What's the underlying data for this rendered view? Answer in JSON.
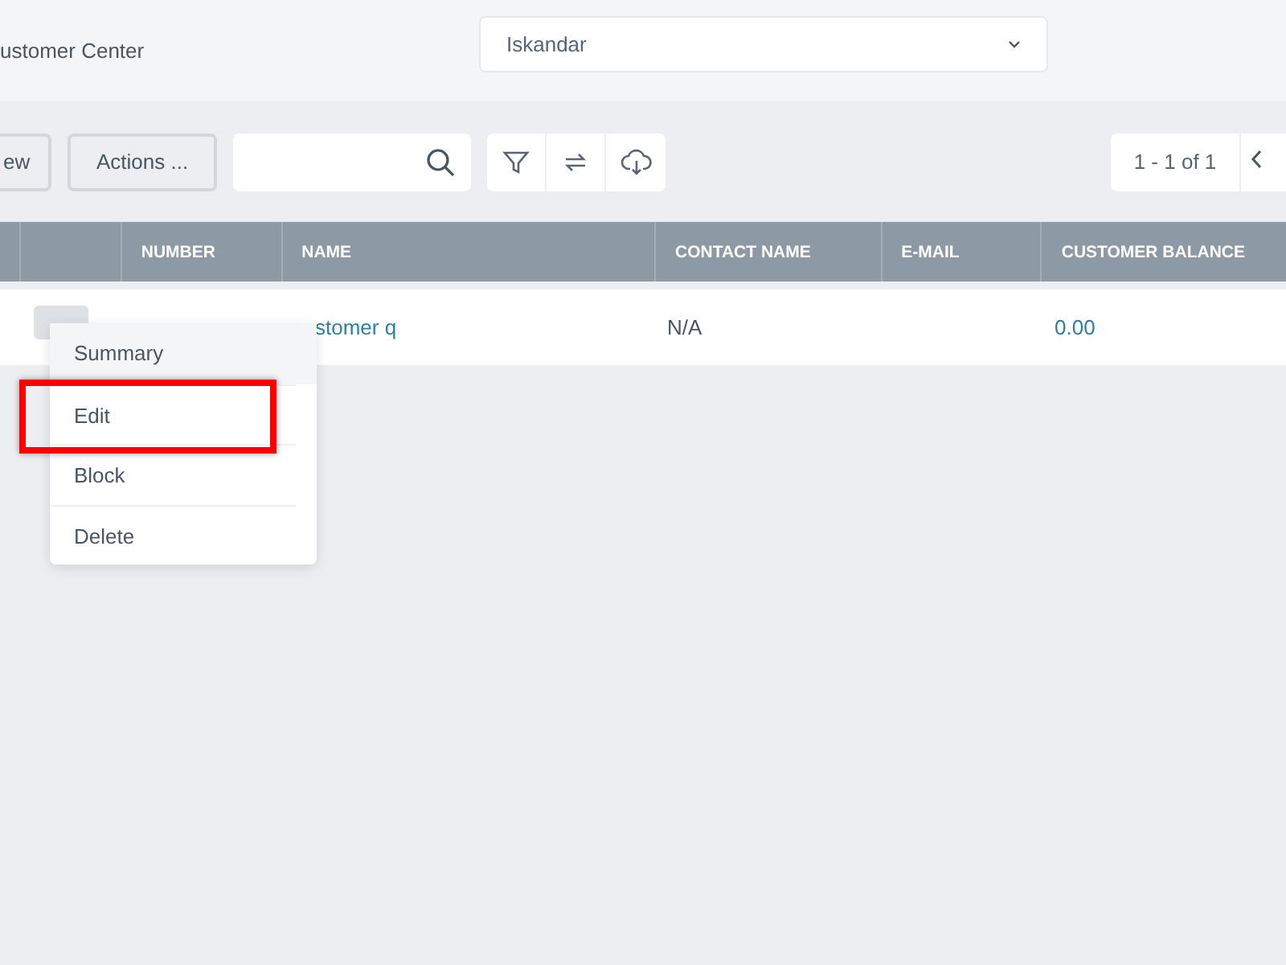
{
  "header": {
    "title": "ustomer Center",
    "customer_select": {
      "value": "Iskandar"
    }
  },
  "toolbar": {
    "buttons": [
      "ew",
      "Actions ..."
    ],
    "pager": "1 - 1 of 1"
  },
  "table": {
    "columns": [
      "NUMBER",
      "NAME",
      "CONTACT NAME",
      "E-MAIL",
      "CUSTOMER BALANCE"
    ],
    "rows": [
      {
        "name": "stomer q",
        "contact_name": "N/A",
        "balance": "0.00"
      }
    ]
  },
  "context_menu": {
    "items": [
      {
        "label": "Summary",
        "hovered": true,
        "highlighted": false
      },
      {
        "label": "Edit",
        "hovered": false,
        "highlighted": true
      },
      {
        "label": "Block",
        "hovered": false,
        "highlighted": false
      },
      {
        "label": "Delete",
        "hovered": false,
        "highlighted": false
      }
    ]
  }
}
